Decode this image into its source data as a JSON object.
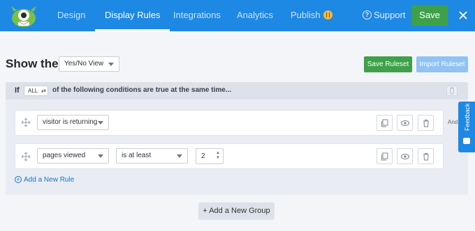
{
  "nav": {
    "tabs": [
      {
        "label": "Design"
      },
      {
        "label": "Display Rules",
        "active": true
      },
      {
        "label": "Integrations"
      },
      {
        "label": "Analytics"
      },
      {
        "label": "Publish"
      }
    ],
    "support_label": "Support",
    "save_label": "Save"
  },
  "header": {
    "show_the_label": "Show the",
    "view_select": "Yes/No View",
    "save_ruleset_label": "Save Ruleset",
    "import_ruleset_label": "Import Ruleset"
  },
  "group": {
    "if_label": "If",
    "match_select": "ALL",
    "condition_text": "of the following conditions are true at the same time...",
    "rules": [
      {
        "field": "visitor is returning"
      },
      {
        "field": "pages viewed",
        "operator": "is at least",
        "value": "2"
      }
    ],
    "and_label": "And",
    "add_rule_label": "Add a New Rule"
  },
  "add_group_label": "+ Add a New Group",
  "feedback_label": "Feedback",
  "colors": {
    "brand_blue": "#1e88e5",
    "save_green": "#3ea14a",
    "import_disabled_blue": "#90c3f2",
    "link_blue": "#1e73be",
    "badge_orange": "#f6b73c"
  },
  "icons": [
    "optinmonster-logo-icon",
    "support-question-icon",
    "close-icon",
    "drag-handle-icon",
    "duplicate-icon",
    "eye-icon",
    "trash-icon",
    "plus-circle-icon",
    "swap-icon",
    "feedback-chat-icon"
  ]
}
